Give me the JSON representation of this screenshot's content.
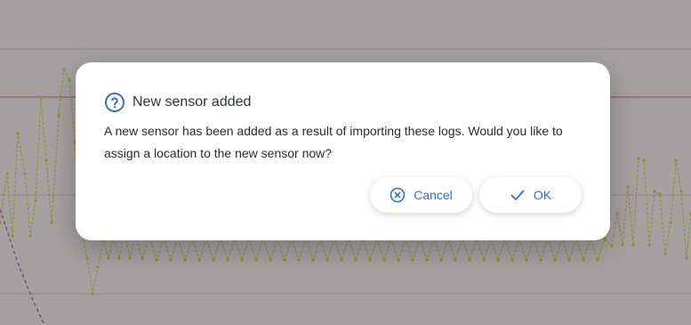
{
  "dialog": {
    "title": "New sensor added",
    "message": "A new sensor has been added as a result of importing these logs. Would you like to assign a location to the new sensor now?",
    "cancel_label": "Cancel",
    "ok_label": "OK",
    "icons": {
      "title": "question-circle-icon",
      "cancel": "x-circle-icon",
      "ok": "checkmark-icon"
    }
  },
  "colors": {
    "accent": "#2f6fd6",
    "overlay": "#504848",
    "series_yellow": "#e2d21a",
    "series_purple": "#5b4bd6",
    "threshold_red": "#e05050"
  }
}
